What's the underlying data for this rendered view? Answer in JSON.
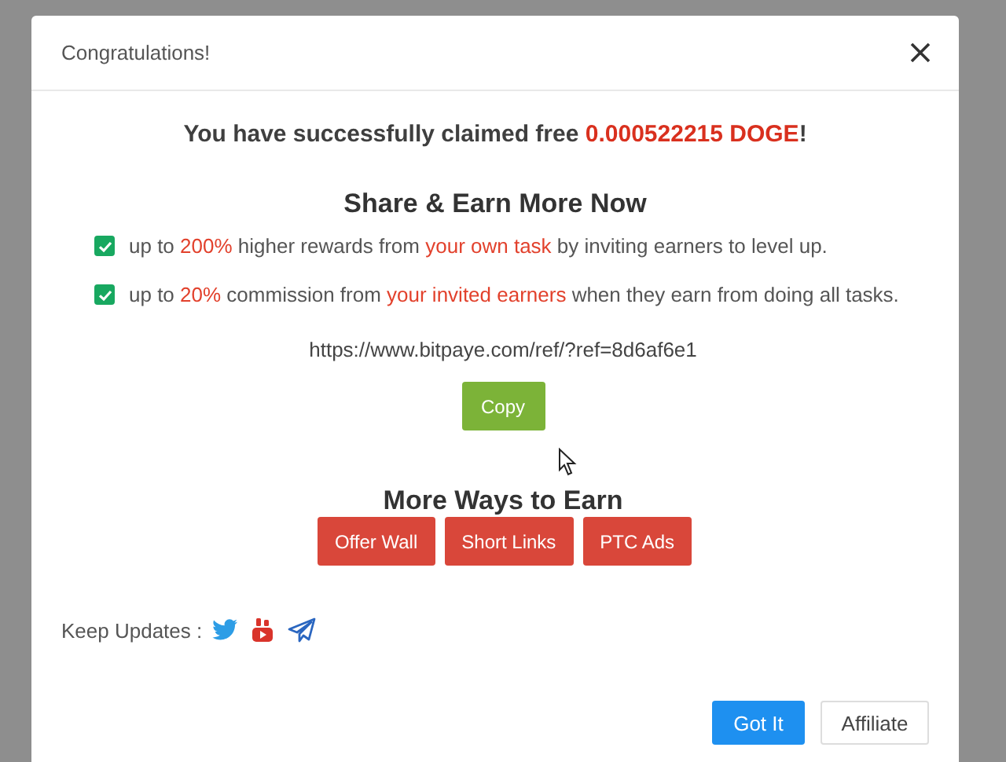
{
  "dialog": {
    "title": "Congratulations!",
    "claim": [
      {
        "text": "You have successfully claimed free ",
        "highlight": false
      },
      {
        "text": "0.000522215 DOGE",
        "highlight": true
      },
      {
        "text": "!",
        "highlight": false
      }
    ],
    "share_heading": "Share & Earn More Now",
    "benefits": [
      {
        "checked": true,
        "parts": [
          {
            "text": "up to ",
            "highlight": false
          },
          {
            "text": "200%",
            "highlight": true
          },
          {
            "text": " higher rewards from ",
            "highlight": false
          },
          {
            "text": "your own task",
            "highlight": true
          },
          {
            "text": " by inviting earners to level up.",
            "highlight": false
          }
        ]
      },
      {
        "checked": true,
        "parts": [
          {
            "text": "up to ",
            "highlight": false
          },
          {
            "text": "20%",
            "highlight": true
          },
          {
            "text": " commission from ",
            "highlight": false
          },
          {
            "text": "your invited earners",
            "highlight": true
          },
          {
            "text": " when they earn from doing all tasks.",
            "highlight": false
          }
        ]
      }
    ],
    "referral_link": "https://www.bitpaye.com/ref/?ref=8d6af6e1",
    "copy_button": "Copy",
    "more_heading": "More Ways to Earn",
    "earn_buttons": [
      "Offer Wall",
      "Short Links",
      "PTC Ads"
    ],
    "keep_updates": "Keep Updates :",
    "social": [
      {
        "kind": "twitter"
      },
      {
        "kind": "youtube"
      },
      {
        "kind": "telegram"
      }
    ],
    "footer_buttons": [
      {
        "label": "Got It",
        "kind": "primary"
      },
      {
        "label": "Affiliate",
        "kind": "default"
      }
    ]
  }
}
